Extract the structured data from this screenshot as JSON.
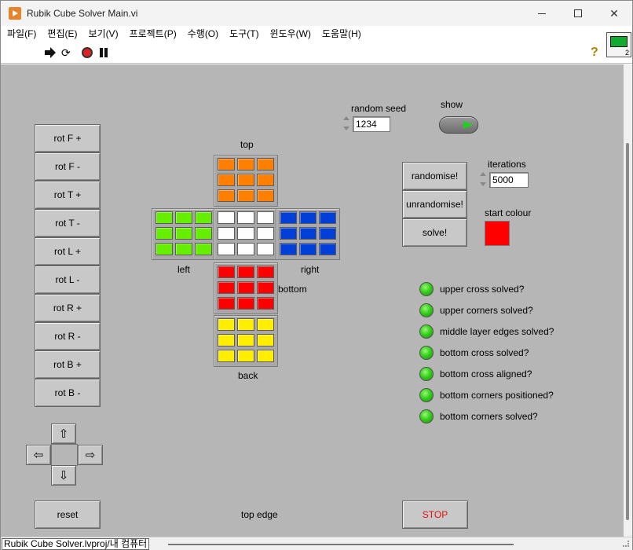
{
  "window": {
    "title": "Rubik Cube Solver Main.vi"
  },
  "menu": [
    "파일(F)",
    "편집(E)",
    "보기(V)",
    "프로젝트(P)",
    "수행(O)",
    "도구(T)",
    "윈도우(W)",
    "도움말(H)"
  ],
  "toolbar": {
    "help": "?",
    "icon_number": "2"
  },
  "rotation_buttons": [
    "rot F +",
    "rot F -",
    "rot T +",
    "rot T -",
    "rot L +",
    "rot L -",
    "rot R +",
    "rot R -",
    "rot B +",
    "rot B -"
  ],
  "nav_arrows": {
    "up": "⇧",
    "left": "⇦",
    "right": "⇨",
    "down": "⇩"
  },
  "reset_label": "reset",
  "face_labels": {
    "top": "top",
    "left": "left",
    "right": "right",
    "bottom": "bottom",
    "back": "back",
    "top_edge": "top edge"
  },
  "face_colors": {
    "top": "#ff8000",
    "left": "#66ee00",
    "front": "#ffffff",
    "right": "#0040d8",
    "bottom": "#ff0000",
    "back": "#ffee00"
  },
  "random_seed": {
    "label": "random seed",
    "value": "1234"
  },
  "show": {
    "label": "show",
    "on": true
  },
  "iterations": {
    "label": "iterations",
    "value": "5000"
  },
  "actions": {
    "randomise": "randomise!",
    "unrandomise": "unrandomise!",
    "solve": "solve!"
  },
  "start_colour": {
    "label": "start colour",
    "color": "#ff0000"
  },
  "status_leds": [
    "upper cross solved?",
    "upper corners solved?",
    "middle layer edges solved?",
    "bottom cross solved?",
    "bottom cross aligned?",
    "bottom corners positioned?",
    "bottom corners solved?"
  ],
  "led_color": "#33d11a",
  "stop_label": "STOP",
  "statusbar": {
    "path": "Rubik Cube Solver.lvproj/내 컴퓨터"
  }
}
